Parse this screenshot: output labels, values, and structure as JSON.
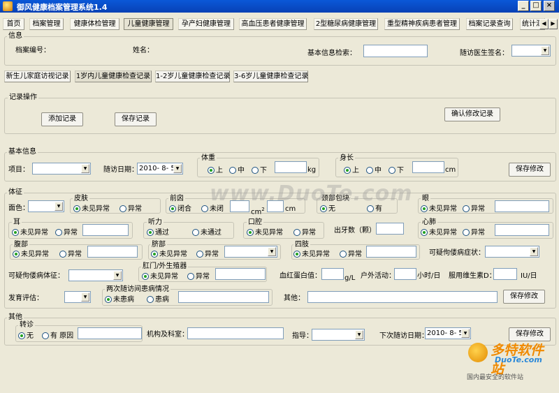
{
  "window": {
    "title": "御风健康档案管理系统1.4"
  },
  "tabs": [
    {
      "label": "首页"
    },
    {
      "label": "档案管理"
    },
    {
      "label": "健康体检管理"
    },
    {
      "label": "儿童健康管理"
    },
    {
      "label": "孕产妇健康管理"
    },
    {
      "label": "高血压患者健康管理"
    },
    {
      "label": "2型糖尿病健康管理"
    },
    {
      "label": "重型精神疾病患者管理"
    },
    {
      "label": "档案记录查询"
    },
    {
      "label": "统计汇"
    }
  ],
  "info": {
    "group_label": "信息",
    "file_no_label": "档案编号：",
    "name_label": "姓名：",
    "search_label": "基本信息检索：",
    "doctor_sign_label": "随访医生签名："
  },
  "subtabs": [
    {
      "label": "新生儿家庭访视记录"
    },
    {
      "label": "1岁内儿童健康检查记录"
    },
    {
      "label": "1-2岁儿童健康检查记录"
    },
    {
      "label": "3-6岁儿童健康检查记录"
    }
  ],
  "record_ops": {
    "group_label": "记录操作",
    "add_label": "添加记录",
    "save_label": "保存记录",
    "confirm_label": "确认修改记录"
  },
  "basic": {
    "group_label": "基本信息",
    "item_label": "项目：",
    "date_label": "随访日期：",
    "date_value": "2010- 8- 5",
    "weight": {
      "label": "体重",
      "opts": [
        "上",
        "中",
        "下"
      ],
      "unit": "kg"
    },
    "height": {
      "label": "身长",
      "opts": [
        "上",
        "中",
        "下"
      ],
      "unit": "cm"
    },
    "save_label": "保存修改"
  },
  "exam": {
    "group_label": "体征",
    "face_label": "面色：",
    "skin": {
      "label": "皮肤",
      "opts": [
        "未见异常",
        "异常"
      ]
    },
    "fontanel": {
      "label": "前囟",
      "opts": [
        "闭合",
        "未闭"
      ],
      "unit1": "cm",
      "unit2": "cm"
    },
    "neck": {
      "label": "颈部包块",
      "opts": [
        "无",
        "有"
      ]
    },
    "eye": {
      "label": "眼",
      "opts": [
        "未见异常",
        "异常"
      ]
    },
    "ear": {
      "label": "耳",
      "opts": [
        "未见异常",
        "异常"
      ]
    },
    "hearing": {
      "label": "听力",
      "opts": [
        "通过",
        "未通过"
      ]
    },
    "mouth": {
      "label": "口腔",
      "opts": [
        "未见异常",
        "异常"
      ]
    },
    "teeth_label": "出牙数（颗）",
    "heartlung": {
      "label": "心肺",
      "opts": [
        "未见异常",
        "异常"
      ]
    },
    "abdomen": {
      "label": "腹部",
      "opts": [
        "未见异常",
        "异常"
      ]
    },
    "navel": {
      "label": "脐部",
      "opts": [
        "未见异常",
        "异常"
      ]
    },
    "limbs": {
      "label": "四肢",
      "opts": [
        "未见异常",
        "异常"
      ]
    },
    "rickets_symptom_label": "可疑佝偻病症状：",
    "rickets_sign_label": "可疑佝偻病体征：",
    "anus": {
      "label": "肛门/外生殖器",
      "opts": [
        "未见异常",
        "异常"
      ]
    },
    "hemoglobin_label": "血红蛋白值：",
    "hemoglobin_unit": "g/L",
    "outdoor_label": "户外活动：",
    "outdoor_unit": "小时/日",
    "vitd_label": "服用维生素D：",
    "vitd_unit": "IU/日",
    "growth_label": "发育评估：",
    "illness": {
      "label": "两次随访间患病情况",
      "opts": [
        "未患病",
        "患病"
      ]
    },
    "other_label": "其他：",
    "save_label": "保存修改"
  },
  "other": {
    "group_label": "其他",
    "referral": {
      "label": "转诊",
      "opts": [
        "无",
        "有 原因"
      ]
    },
    "dept_label": "机构及科室：",
    "guide_label": "指导：",
    "next_date_label": "下次随访日期：",
    "next_date_value": "2010- 8- 5",
    "save_label": "保存修改"
  },
  "watermark": "www.DuoTe.com",
  "logo": {
    "big": "多特软件站",
    "site": "DuoTe.com",
    "slogan": "国内最安全的软件站"
  },
  "colors": {
    "title_bar": "#0a58d8",
    "window_bg": "#ece9d8",
    "radio_selected": "#21a121"
  }
}
